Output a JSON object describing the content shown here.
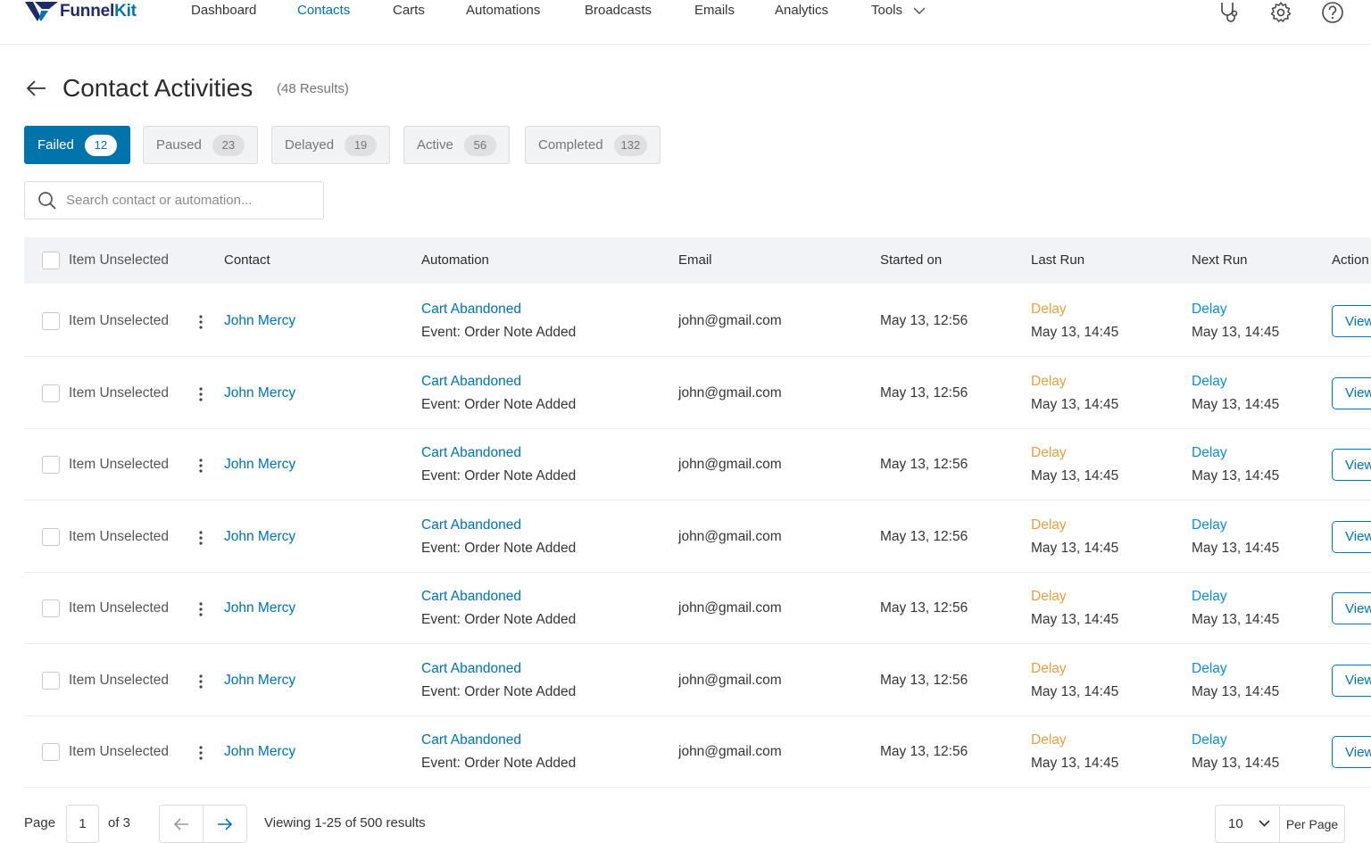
{
  "brand": {
    "name_main": "Funnel",
    "name_accent": "Kit"
  },
  "nav": [
    {
      "label": "Dashboard",
      "active": false
    },
    {
      "label": "Contacts",
      "active": true
    },
    {
      "label": "Carts",
      "active": false
    },
    {
      "label": "Automations",
      "active": false
    },
    {
      "label": "Broadcasts",
      "active": false
    },
    {
      "label": "Emails",
      "active": false
    },
    {
      "label": "Analytics",
      "active": false
    },
    {
      "label": "Tools",
      "active": false
    }
  ],
  "header_icons": [
    "stethoscope-icon",
    "gear-icon",
    "help-icon"
  ],
  "page": {
    "title": "Contact Activities",
    "results": "(48 Results)"
  },
  "tabs": [
    {
      "label": "Failed",
      "count": "12",
      "active": true
    },
    {
      "label": "Paused",
      "count": "23",
      "active": false
    },
    {
      "label": "Delayed",
      "count": "19",
      "active": false
    },
    {
      "label": "Active",
      "count": "56",
      "active": false
    },
    {
      "label": "Completed",
      "count": "132",
      "active": false
    }
  ],
  "search": {
    "placeholder": "Search contact or automation..."
  },
  "table": {
    "select_all_label": "Item Unselected",
    "columns": [
      "Contact",
      "Automation",
      "Email",
      "Started on",
      "Last Run",
      "Next Run",
      "Action"
    ],
    "rows": [
      {
        "select_label": "Item Unselected",
        "contact": "John Mercy",
        "automation": "Cart Abandoned",
        "event": "Event: Order Note Added",
        "email": "john@gmail.com",
        "started": "May 13, 12:56",
        "last_status": "Delay",
        "last_time": "May 13, 14:45",
        "next_status": "Delay",
        "next_time": "May 13, 14:45",
        "action": "View"
      },
      {
        "select_label": "Item Unselected",
        "contact": "John Mercy",
        "automation": "Cart Abandoned",
        "event": "Event: Order Note Added",
        "email": "john@gmail.com",
        "started": "May 13, 12:56",
        "last_status": "Delay",
        "last_time": "May 13, 14:45",
        "next_status": "Delay",
        "next_time": "May 13, 14:45",
        "action": "View"
      },
      {
        "select_label": "Item Unselected",
        "contact": "John Mercy",
        "automation": "Cart Abandoned",
        "event": "Event: Order Note Added",
        "email": "john@gmail.com",
        "started": "May 13, 12:56",
        "last_status": "Delay",
        "last_time": "May 13, 14:45",
        "next_status": "Delay",
        "next_time": "May 13, 14:45",
        "action": "View"
      },
      {
        "select_label": "Item Unselected",
        "contact": "John Mercy",
        "automation": "Cart Abandoned",
        "event": "Event: Order Note Added",
        "email": "john@gmail.com",
        "started": "May 13, 12:56",
        "last_status": "Delay",
        "last_time": "May 13, 14:45",
        "next_status": "Delay",
        "next_time": "May 13, 14:45",
        "action": "View"
      },
      {
        "select_label": "Item Unselected",
        "contact": "John Mercy",
        "automation": "Cart Abandoned",
        "event": "Event: Order Note Added",
        "email": "john@gmail.com",
        "started": "May 13, 12:56",
        "last_status": "Delay",
        "last_time": "May 13, 14:45",
        "next_status": "Delay",
        "next_time": "May 13, 14:45",
        "action": "View"
      },
      {
        "select_label": "Item Unselected",
        "contact": "John Mercy",
        "automation": "Cart Abandoned",
        "event": "Event: Order Note Added",
        "email": "john@gmail.com",
        "started": "May 13, 12:56",
        "last_status": "Delay",
        "last_time": "May 13, 14:45",
        "next_status": "Delay",
        "next_time": "May 13, 14:45",
        "action": "View"
      },
      {
        "select_label": "Item Unselected",
        "contact": "John Mercy",
        "automation": "Cart Abandoned",
        "event": "Event: Order Note Added",
        "email": "john@gmail.com",
        "started": "May 13, 12:56",
        "last_status": "Delay",
        "last_time": "May 13, 14:45",
        "next_status": "Delay",
        "next_time": "May 13, 14:45",
        "action": "View"
      }
    ]
  },
  "pagination": {
    "page_label": "Page",
    "current_page": "1",
    "of_label": "of 3",
    "viewing": "Viewing  1-25 of 500 results",
    "per_page_value": "10",
    "per_page_label": "Per Page"
  },
  "colors": {
    "accent": "#0073aa",
    "delay_orange": "#e3a047",
    "delay_blue": "#0f8bd0"
  }
}
